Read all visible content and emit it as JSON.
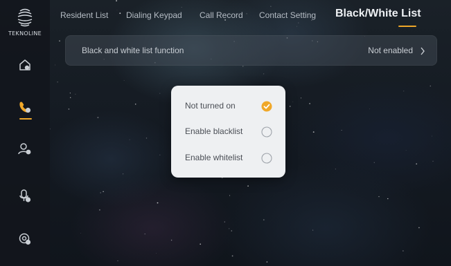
{
  "brand": {
    "logo_text": "TEKNOLINE"
  },
  "colors": {
    "accent": "#f0a829",
    "popup_bg": "#eef0f2"
  },
  "sidebar": {
    "items": [
      {
        "icon": "home-icon",
        "active": false
      },
      {
        "icon": "phone-icon",
        "active": true
      },
      {
        "icon": "person-card-icon",
        "active": false
      },
      {
        "icon": "audio-person-icon",
        "active": false
      },
      {
        "icon": "settings-gear-icon",
        "active": false
      }
    ]
  },
  "tabs": [
    {
      "label": "Resident List",
      "active": false
    },
    {
      "label": "Dialing Keypad",
      "active": false
    },
    {
      "label": "Call Record",
      "active": false
    },
    {
      "label": "Contact Setting",
      "active": false
    },
    {
      "label": "Black/White List",
      "active": true
    }
  ],
  "setting": {
    "label": "Black and white list function",
    "value": "Not enabled"
  },
  "popup": {
    "options": [
      {
        "label": "Not turned on",
        "selected": true
      },
      {
        "label": "Enable blacklist",
        "selected": false
      },
      {
        "label": "Enable whitelist",
        "selected": false
      }
    ]
  }
}
